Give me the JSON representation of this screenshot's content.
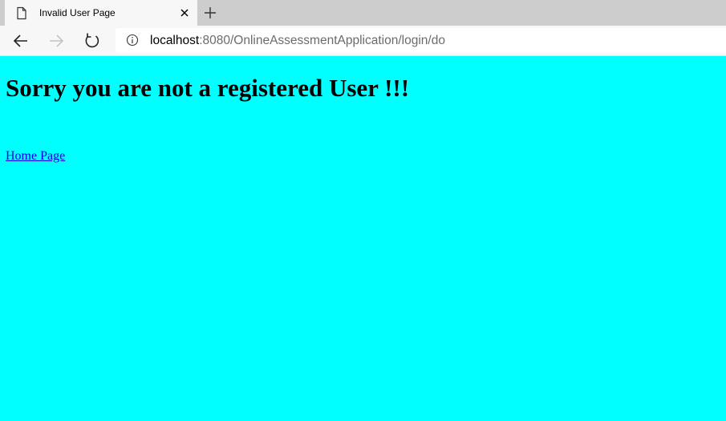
{
  "browser": {
    "tab": {
      "title": "Invalid User Page",
      "icon": "page-icon",
      "close_icon": "close-icon"
    },
    "new_tab_icon": "plus-icon",
    "toolbar": {
      "back_icon": "back-arrow-icon",
      "forward_icon": "forward-arrow-icon",
      "reload_icon": "reload-icon",
      "info_icon": "info-icon"
    },
    "address": {
      "host": "localhost",
      "rest": ":8080/OnlineAssessmentApplication/login/do"
    }
  },
  "page": {
    "background": "#00ffff",
    "heading": "Sorry you are not a registered User !!!",
    "home_link": "Home Page"
  }
}
